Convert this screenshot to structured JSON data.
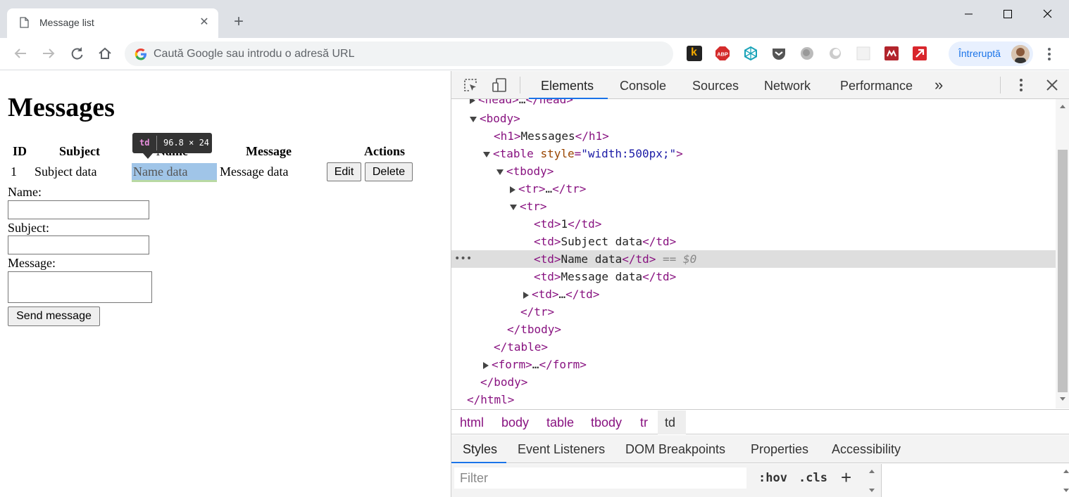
{
  "browser": {
    "tab_title": "Message list",
    "tab_close": "✕",
    "new_tab": "+",
    "omnibox_placeholder": "Caută Google sau introdu o adresă URL",
    "profile_label": "Întreruptă"
  },
  "page": {
    "heading": "Messages",
    "table": {
      "headers": [
        "ID",
        "Subject",
        "Name",
        "Message",
        "Actions"
      ],
      "row": [
        "1",
        "Subject data",
        "Name data",
        "Message data"
      ],
      "edit_label": "Edit",
      "delete_label": "Delete"
    },
    "form": {
      "name_label": "Name:",
      "subject_label": "Subject:",
      "message_label": "Message:",
      "send_label": "Send message"
    },
    "inspector_tip": {
      "tag": "td",
      "size": "96.8 × 24"
    }
  },
  "devtools": {
    "tabs": [
      "Elements",
      "Console",
      "Sources",
      "Network",
      "Performance"
    ],
    "more_tabs": "»",
    "breadcrumbs": [
      "html",
      "body",
      "table",
      "tbody",
      "tr",
      "td"
    ],
    "sub_tabs": [
      "Styles",
      "Event Listeners",
      "DOM Breakpoints",
      "Properties",
      "Accessibility"
    ],
    "filter_placeholder": "Filter",
    "hov": ":hov",
    "cls": ".cls",
    "plus": "+",
    "selected_marker": "== $0",
    "dots": "•••"
  }
}
